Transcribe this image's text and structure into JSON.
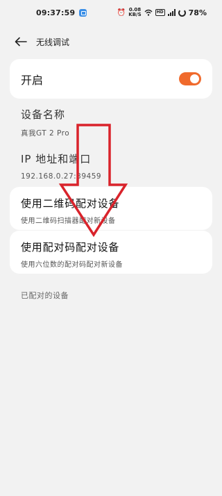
{
  "status_bar": {
    "time": "09:37:59",
    "net_speed_value": "0.08",
    "net_speed_unit": "KB/S",
    "hd": "HD",
    "battery": "78%"
  },
  "header": {
    "title": "无线调试"
  },
  "toggle": {
    "label": "开启",
    "state": "on",
    "color": "#f06a2c"
  },
  "device_name": {
    "label": "设备名称",
    "value": "真我GT 2 Pro"
  },
  "ip": {
    "label": "IP 地址和端口",
    "value": "192.168.0.27:39459"
  },
  "pair_qr": {
    "title": "使用二维码配对设备",
    "subtitle": "使用二维码扫描器配对新设备"
  },
  "pair_code": {
    "title": "使用配对码配对设备",
    "subtitle": "使用六位数的配对码配对新设备"
  },
  "paired_devices": {
    "header": "已配对的设备"
  },
  "annotation": {
    "arrow_color": "#d9232b"
  }
}
